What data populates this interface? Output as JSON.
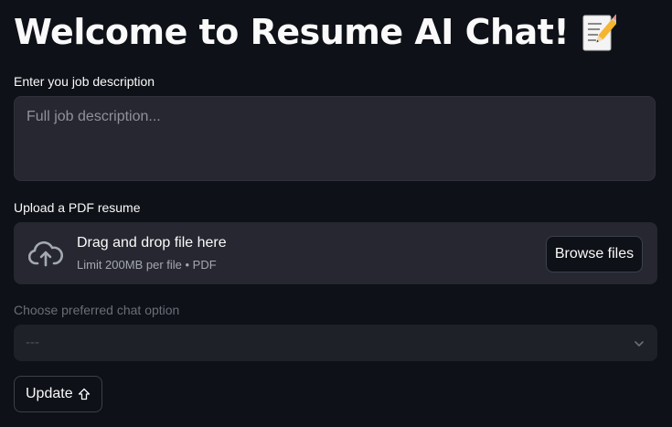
{
  "page": {
    "title": "Welcome to Resume AI Chat!",
    "title_icon": "memo-pencil-icon"
  },
  "job_description": {
    "label": "Enter you job description",
    "placeholder": "Full job description...",
    "value": ""
  },
  "uploader": {
    "label": "Upload a PDF resume",
    "icon": "cloud-upload-icon",
    "drag_text": "Drag and drop file here",
    "limit_text": "Limit 200MB per file • PDF",
    "browse_label": "Browse files"
  },
  "chat_option": {
    "label": "Choose preferred chat option",
    "selected": "---",
    "icon": "chevron-down-icon",
    "disabled": true
  },
  "update_button": {
    "label": "Update",
    "icon": "arrow-up-icon"
  },
  "colors": {
    "background": "#0e1117",
    "surface": "#262730",
    "text": "#fafafa",
    "muted_text": "#6b6e78"
  }
}
